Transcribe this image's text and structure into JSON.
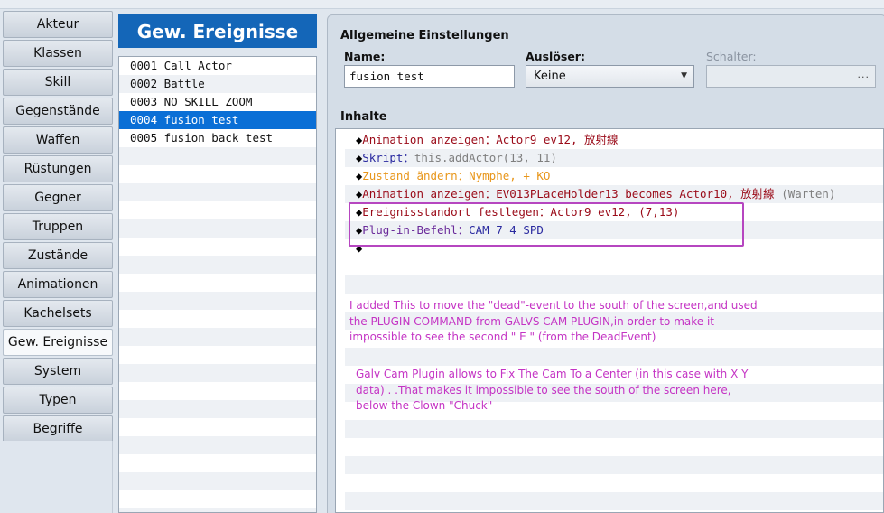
{
  "tabs": [
    "Akteur",
    "Klassen",
    "Skill",
    "Gegenstände",
    "Waffen",
    "Rüstungen",
    "Gegner",
    "Truppen",
    "Zustände",
    "Animationen",
    "Kachelsets",
    "Gew. Ereignisse",
    "System",
    "Typen",
    "Begriffe"
  ],
  "active_tab": "Gew. Ereignisse",
  "list": {
    "title": "Gew. Ereignisse",
    "items": [
      "0001 Call Actor",
      "0002 Battle",
      "0003 NO SKILL ZOOM",
      "0004 fusion test",
      "0005 fusion back test"
    ],
    "selected_index": 3
  },
  "settings": {
    "section_title": "Allgemeine Einstellungen",
    "name_label": "Name:",
    "name_value": "fusion test",
    "trigger_label": "Auslöser:",
    "trigger_value": "Keine",
    "switch_label": "Schalter:",
    "switch_button": "..."
  },
  "contents": {
    "section_title": "Inhalte",
    "rows": [
      {
        "command": "Animation anzeigen",
        "params": "Actor9 ev12, 放射線",
        "suffix": "",
        "color": "maroon"
      },
      {
        "command": "Skript",
        "params": "this.addActor(13, 11)",
        "suffix": "",
        "color": "navy"
      },
      {
        "command": "Zustand ändern",
        "params": "Nymphe, + KO",
        "suffix": "",
        "color": "orange"
      },
      {
        "command": "Animation anzeigen",
        "params": "EV013PLaceHolder13 becomes Actor10, 放射線",
        "suffix": "(Warten)",
        "color": "maroon"
      },
      {
        "command": "Ereignisstandort festlegen",
        "params": "Actor9 ev12, (7,13)",
        "suffix": "",
        "color": "maroon"
      },
      {
        "command": "Plug-in-Befehl",
        "params": "CAM 7 4 SPD",
        "suffix": "",
        "color": "purple"
      },
      {
        "command": "",
        "params": "",
        "suffix": "",
        "color": "maroon"
      }
    ]
  },
  "annotations": {
    "note1": [
      "I added This to move the \"dead\"-event to the south of the screen,and used",
      "the PLUGIN COMMAND from GALVS CAM PLUGIN,in order to make it",
      "impossible to see the second \" E \" (from the DeadEvent)"
    ],
    "note2": [
      "Galv Cam Plugin allows to Fix The Cam To a Center (in this case with X Y",
      "data) . .That makes it impossible to see the south of the screen here,",
      "below the Clown \"Chuck\""
    ],
    "color": "#c433c4"
  }
}
